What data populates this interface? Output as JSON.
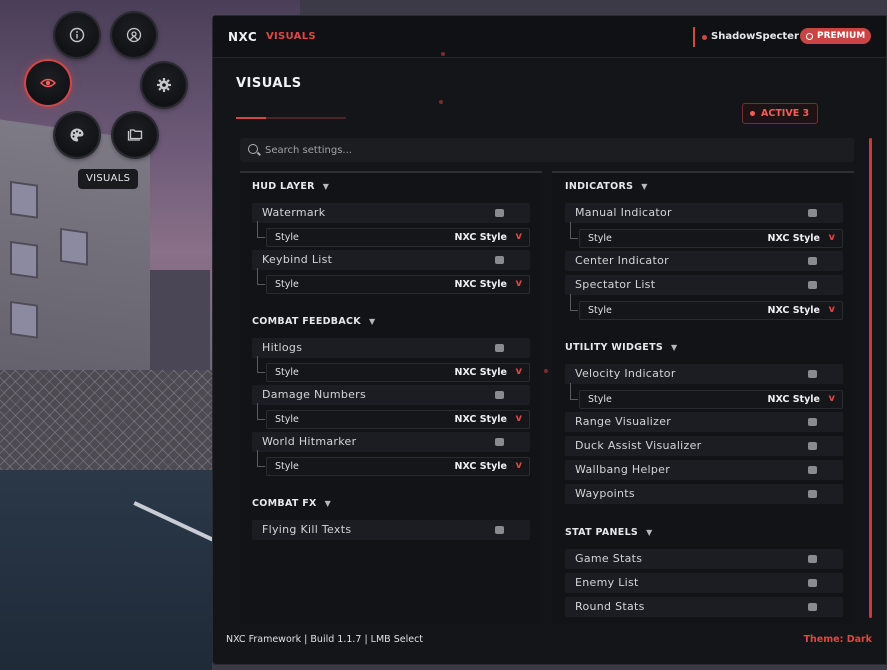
{
  "radial_menu": {
    "tooltip": "VISUALS",
    "buttons": [
      {
        "name": "info-icon"
      },
      {
        "name": "target-icon"
      },
      {
        "name": "eye-icon",
        "active": true
      },
      {
        "name": "gear-icon"
      },
      {
        "name": "palette-icon"
      },
      {
        "name": "folder-icon"
      }
    ]
  },
  "titlebar": {
    "brand": "NXC",
    "section": "VISUALS",
    "username": "ShadowSpecter",
    "premium_label": "PREMIUM"
  },
  "header": {
    "title": "VISUALS",
    "active_badge": "ACTIVE 3"
  },
  "search": {
    "placeholder": "Search settings..."
  },
  "style_label": "Style",
  "style_value": "NXC Style",
  "chevron": "v",
  "left_column": {
    "hud_layer": {
      "title": "HUD LAYER",
      "items": [
        {
          "label": "Watermark",
          "style": true
        },
        {
          "label": "Keybind List",
          "style": true
        }
      ]
    },
    "combat_feedback": {
      "title": "COMBAT FEEDBACK",
      "items": [
        {
          "label": "Hitlogs",
          "style": true
        },
        {
          "label": "Damage Numbers",
          "style": true
        },
        {
          "label": "World Hitmarker",
          "style": true
        }
      ]
    },
    "combat_fx": {
      "title": "COMBAT FX",
      "items": [
        {
          "label": "Flying Kill Texts",
          "style": false
        }
      ]
    }
  },
  "right_column": {
    "indicators": {
      "title": "INDICATORS",
      "items": [
        {
          "label": "Manual Indicator",
          "style": true
        },
        {
          "label": "Center Indicator",
          "style": false
        },
        {
          "label": "Spectator List",
          "style": true
        }
      ]
    },
    "utility_widgets": {
      "title": "UTILITY WIDGETS",
      "items": [
        {
          "label": "Velocity Indicator",
          "style": true
        },
        {
          "label": "Range Visualizer",
          "style": false
        },
        {
          "label": "Duck Assist Visualizer",
          "style": false
        },
        {
          "label": "Wallbang Helper",
          "style": false
        },
        {
          "label": "Waypoints",
          "style": false
        }
      ]
    },
    "stat_panels": {
      "title": "STAT PANELS",
      "items": [
        {
          "label": "Game Stats",
          "style": false
        },
        {
          "label": "Enemy List",
          "style": false
        },
        {
          "label": "Round Stats",
          "style": false
        }
      ]
    }
  },
  "footer": {
    "left": "NXC Framework | Build 1.1.7 | LMB Select",
    "right": "Theme: Dark"
  }
}
